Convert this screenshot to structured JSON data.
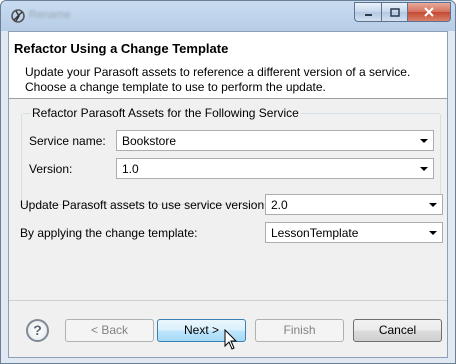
{
  "window": {
    "title": "Rename",
    "controls": {
      "minimize": "minimize",
      "maximize": "maximize",
      "close": "close"
    }
  },
  "banner": {
    "title": "Refactor Using a Change Template",
    "description": "Update your Parasoft assets to reference a different version of a service.  Choose a change template to use to perform the update."
  },
  "group": {
    "title": "Refactor Parasoft Assets for the Following Service",
    "service_name_label": "Service name:",
    "service_name_value": "Bookstore",
    "version_label": "Version:",
    "version_value": "1.0"
  },
  "update": {
    "label": "Update Parasoft assets to use service version:",
    "value": "2.0"
  },
  "template": {
    "label": "By applying the change template:",
    "value": "LessonTemplate"
  },
  "buttons": {
    "help": "?",
    "back": "< Back",
    "next": "Next >",
    "finish": "Finish",
    "cancel": "Cancel"
  }
}
